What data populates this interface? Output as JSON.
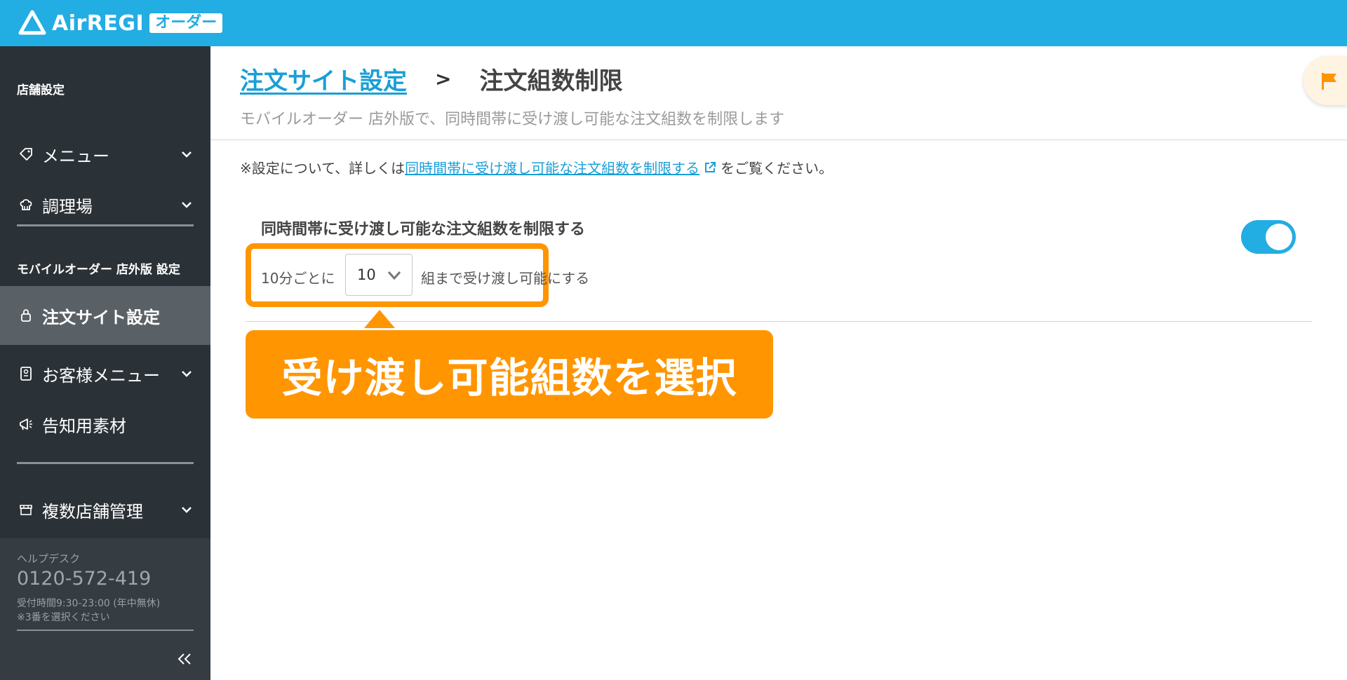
{
  "header": {
    "logo_text": "AirREGI",
    "logo_badge": "オーダー",
    "brand_color": "#22ade3"
  },
  "sidebar": {
    "section1_title": "店舗設定",
    "items1": [
      {
        "label": "メニュー",
        "icon": "tag-icon",
        "has_chevron": true
      },
      {
        "label": "調理場",
        "icon": "chef-hat-icon",
        "has_chevron": true
      }
    ],
    "section2_title": "モバイルオーダー 店外版 設定",
    "items2": [
      {
        "label": "注文サイト設定",
        "icon": "lock-icon",
        "active": true
      },
      {
        "label": "お客様メニュー",
        "icon": "menu-card-icon",
        "has_chevron": true
      },
      {
        "label": "告知用素材",
        "icon": "megaphone-icon"
      }
    ],
    "items3": [
      {
        "label": "複数店舗管理",
        "icon": "store-icon",
        "has_chevron": true
      }
    ],
    "help": {
      "title": "ヘルプデスク",
      "phone": "0120-572-419",
      "hours": "受付時間9:30-23:00 (年中無休)",
      "note": "※3番を選択ください"
    }
  },
  "main": {
    "breadcrumb_parent": "注文サイト設定",
    "breadcrumb_sep": ">",
    "breadcrumb_current": "注文組数制限",
    "subtitle": "モバイルオーダー 店外版で、同時間帯に受け渡し可能な注文組数を制限します",
    "note_prefix": "※設定について、詳しくは",
    "note_link": "同時間帯に受け渡し可能な注文組数を制限する",
    "note_suffix": "をご覧ください。",
    "setting_label": "同時間帯に受け渡し可能な注文組数を制限する",
    "toggle_on": true,
    "row_prefix": "10分ごとに",
    "select_value": "10",
    "row_suffix": "組まで受け渡し可能にする",
    "callout_text": "受け渡し可能組数を選択",
    "accent_color": "#ff9500"
  }
}
